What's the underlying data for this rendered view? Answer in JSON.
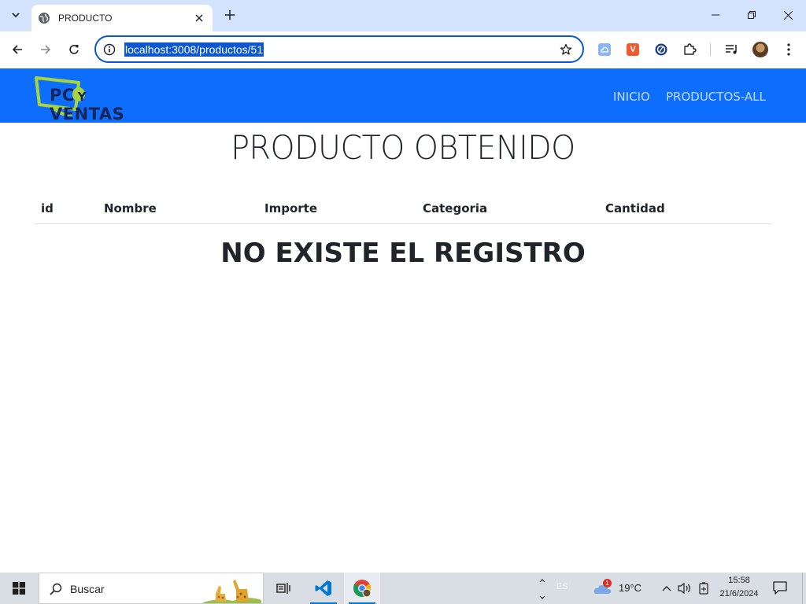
{
  "browser": {
    "tab_title": "PRODUCTO",
    "url": "localhost:3008/productos/51"
  },
  "site": {
    "brand_pc": "PC",
    "brand_y": "Y",
    "brand_ventas": "VENTAS",
    "nav": [
      "INICIO",
      "PRODUCTOS-ALL"
    ],
    "colors": {
      "navbar": "#0d6efd",
      "brand_green": "#a8d63a",
      "brand_text": "#15255a"
    }
  },
  "page": {
    "title": "PRODUCTO OBTENIDO",
    "columns": [
      "id",
      "Nombre",
      "Importe",
      "Categoria",
      "Cantidad"
    ],
    "empty_message": "NO EXISTE EL REGISTRO"
  },
  "taskbar": {
    "search_placeholder": "Buscar",
    "language": "ES",
    "temperature": "19°C",
    "weather_badge": "1",
    "time": "15:58",
    "date": "21/6/2024"
  }
}
